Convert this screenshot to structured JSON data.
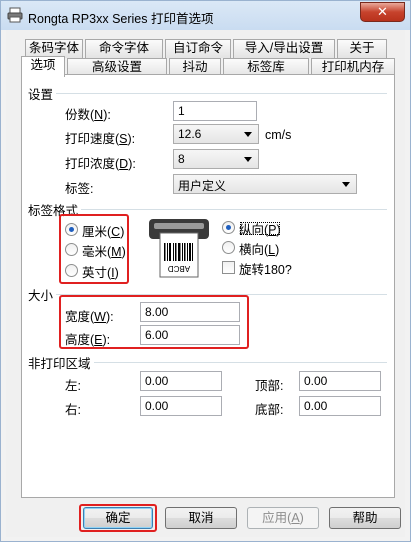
{
  "window": {
    "title": "Rongta RP3xx Series 打印首选项",
    "close_glyph": "✕"
  },
  "tabs_row1": [
    "条码字体",
    "命令字体",
    "自订命令",
    "导入/导出设置",
    "关于"
  ],
  "tabs_row2": [
    "选项",
    "高级设置",
    "抖动",
    "标签库",
    "打印机内存"
  ],
  "active_tab": "选项",
  "settings": {
    "group_title": "设置",
    "copies_label": "份数(",
    "copies_key": "N",
    "copies_end": "):",
    "copies_value": "1",
    "speed_label": "打印速度(",
    "speed_key": "S",
    "speed_end": "):",
    "speed_value": "12.6",
    "speed_unit": "cm/s",
    "density_label": "打印浓度(",
    "density_key": "D",
    "density_end": "):",
    "density_value": "8",
    "label_label": "标签:",
    "label_value": "用户定义"
  },
  "label_format": {
    "group_title": "标签格式",
    "units": [
      {
        "label": "厘米(",
        "key": "C",
        "end": ")",
        "checked": true
      },
      {
        "label": "毫米(",
        "key": "M",
        "end": ")",
        "checked": false
      },
      {
        "label": "英寸(",
        "key": "I",
        "end": ")",
        "checked": false
      }
    ],
    "preview_text": "ABCD",
    "orientation": [
      {
        "label": "纵向(",
        "key": "P",
        "end": ")",
        "checked": true
      },
      {
        "label": "横向(",
        "key": "L",
        "end": ")",
        "checked": false
      }
    ],
    "rotate_label": "旋转180?",
    "rotate_checked": false
  },
  "size": {
    "group_title": "大小",
    "width_label": "宽度(",
    "width_key": "W",
    "width_end": "):",
    "width_value": "8.00",
    "height_label": "高度(",
    "height_key": "E",
    "height_end": "):",
    "height_value": "6.00"
  },
  "non_print": {
    "group_title": "非打印区域",
    "left_label": "左:",
    "left_value": "0.00",
    "top_label": "顶部:",
    "top_value": "0.00",
    "right_label": "右:",
    "right_value": "0.00",
    "bottom_label": "底部:",
    "bottom_value": "0.00"
  },
  "buttons": {
    "ok": "确定",
    "cancel": "取消",
    "apply": "应用(",
    "apply_key": "A",
    "apply_end": ")",
    "help": "帮助"
  },
  "colors": {
    "highlight": "#e02020",
    "titlebar": "#c9dcf1"
  }
}
